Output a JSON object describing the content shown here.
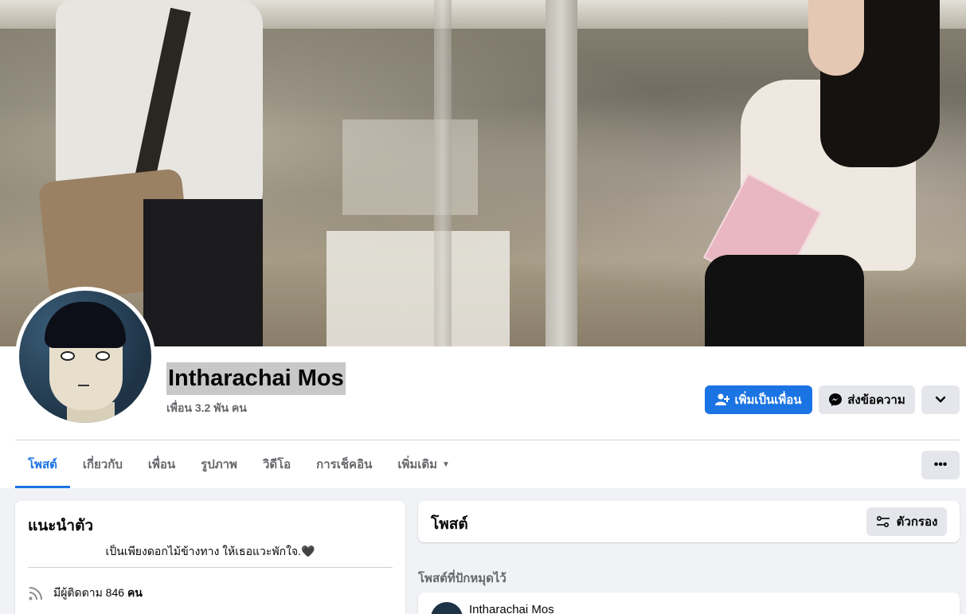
{
  "profile": {
    "name": "Intharachai Mos",
    "friends": "เพื่อน 3.2 พัน คน"
  },
  "actions": {
    "add_friend": "เพิ่มเป็นเพื่อน",
    "message": "ส่งข้อความ"
  },
  "tabs": [
    {
      "label": "โพสต์",
      "active": true
    },
    {
      "label": "เกี่ยวกับ"
    },
    {
      "label": "เพื่อน"
    },
    {
      "label": "รูปภาพ"
    },
    {
      "label": "วิดีโอ"
    },
    {
      "label": "การเช็คอิน"
    },
    {
      "label": "เพิ่มเติม"
    }
  ],
  "intro": {
    "title": "แนะนำตัว",
    "bio": "เป็นเพียงดอกไม้ข้างทาง ให้เธอแวะพักใจ.🖤",
    "followers_prefix": "มีผู้ติดตาม 846",
    "followers_suffix": "คน"
  },
  "posts": {
    "title": "โพสต์",
    "filter_label": "ตัวกรอง",
    "pinned_label": "โพสต์ที่ปักหมุดไว้",
    "pinned_author": "Intharachai Mos"
  },
  "colors": {
    "accent": "#1b74e4",
    "secondary_button": "#e4e6eb",
    "page_bg": "#f0f2f5"
  }
}
